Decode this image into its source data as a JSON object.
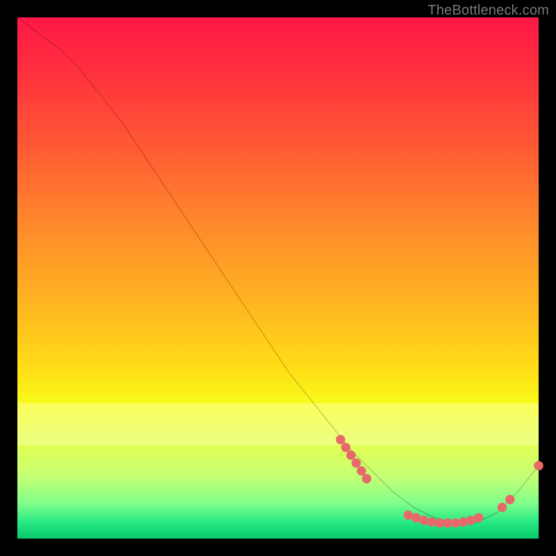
{
  "watermark": "TheBottleneck.com",
  "chart_data": {
    "type": "line",
    "title": "",
    "xlabel": "",
    "ylabel": "",
    "xlim": [
      0,
      100
    ],
    "ylim": [
      0,
      100
    ],
    "grid": false,
    "legend": false,
    "series": [
      {
        "name": "curve",
        "color": "#000000",
        "x": [
          0,
          4,
          8,
          12,
          16,
          20,
          24,
          28,
          32,
          36,
          40,
          44,
          48,
          52,
          56,
          60,
          64,
          68,
          72,
          76,
          80,
          84,
          88,
          92,
          96,
          100
        ],
        "y": [
          100,
          97,
          94,
          90,
          85,
          80,
          74,
          68,
          62,
          56,
          50,
          44,
          38,
          32,
          27,
          22,
          17,
          13,
          9,
          6,
          4,
          3,
          3,
          5,
          9,
          14
        ]
      }
    ],
    "markers": [
      {
        "x": 62,
        "y": 19
      },
      {
        "x": 63,
        "y": 17.5
      },
      {
        "x": 64,
        "y": 16
      },
      {
        "x": 65,
        "y": 14.5
      },
      {
        "x": 66,
        "y": 13
      },
      {
        "x": 67,
        "y": 11.5
      },
      {
        "x": 75,
        "y": 4.5
      },
      {
        "x": 76.5,
        "y": 4
      },
      {
        "x": 78,
        "y": 3.5
      },
      {
        "x": 79.5,
        "y": 3.2
      },
      {
        "x": 81,
        "y": 3
      },
      {
        "x": 82.5,
        "y": 3
      },
      {
        "x": 84,
        "y": 3
      },
      {
        "x": 85.5,
        "y": 3.2
      },
      {
        "x": 87,
        "y": 3.5
      },
      {
        "x": 88.5,
        "y": 4
      },
      {
        "x": 93,
        "y": 6
      },
      {
        "x": 94.5,
        "y": 7.5
      },
      {
        "x": 100,
        "y": 14
      }
    ],
    "marker_color": "#e66a6a",
    "gradient_stops": [
      {
        "pos": 0,
        "color": "#ff1846"
      },
      {
        "pos": 25,
        "color": "#ff5a34"
      },
      {
        "pos": 55,
        "color": "#ffb521"
      },
      {
        "pos": 75,
        "color": "#f6ff1b"
      },
      {
        "pos": 93,
        "color": "#84ff8a"
      },
      {
        "pos": 100,
        "color": "#08c86b"
      }
    ]
  }
}
